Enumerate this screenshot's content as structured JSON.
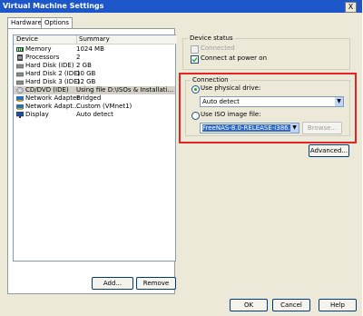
{
  "window": {
    "title": "Virtual Machine Settings",
    "close_glyph": "X"
  },
  "tabs": [
    {
      "label": "Hardware",
      "active": true
    },
    {
      "label": "Options",
      "active": false
    }
  ],
  "device_list": {
    "headers": {
      "device": "Device",
      "summary": "Summary"
    },
    "rows": [
      {
        "device": "Memory",
        "summary": "1024 MB",
        "icon": "memory-icon",
        "selected": false
      },
      {
        "device": "Processors",
        "summary": "2",
        "icon": "processor-icon",
        "selected": false
      },
      {
        "device": "Hard Disk (IDE)",
        "summary": "2 GB",
        "icon": "hard-disk-icon",
        "selected": false
      },
      {
        "device": "Hard Disk 2 (IDE)",
        "summary": "10 GB",
        "icon": "hard-disk-icon",
        "selected": false
      },
      {
        "device": "Hard Disk 3 (IDE)",
        "summary": "12 GB",
        "icon": "hard-disk-icon",
        "selected": false
      },
      {
        "device": "CD/DVD (IDE)",
        "summary": "Using file D:\\ISOs & Installati...",
        "icon": "cd-dvd-icon",
        "selected": true
      },
      {
        "device": "Network Adapter",
        "summary": "Bridged",
        "icon": "network-adapter-icon",
        "selected": false
      },
      {
        "device": "Network Adapt...",
        "summary": "Custom (VMnet1)",
        "icon": "network-adapter-icon",
        "selected": false
      },
      {
        "device": "Display",
        "summary": "Auto detect",
        "icon": "display-icon",
        "selected": false
      }
    ]
  },
  "list_buttons": {
    "add": "Add...",
    "remove": "Remove"
  },
  "device_status": {
    "title": "Device status",
    "connected": {
      "label": "Connected",
      "checked": false,
      "enabled": false
    },
    "connect_at_power_on": {
      "label": "Connect at power on",
      "checked": true
    }
  },
  "connection": {
    "title": "Connection",
    "physical": {
      "label": "Use physical drive:",
      "selected": true,
      "value": "Auto detect"
    },
    "iso": {
      "label": "Use ISO image file:",
      "selected": false,
      "value": "FreeNAS-8.0-RELEASE-i386.iso",
      "browse_label": "Browse..."
    }
  },
  "advanced_label": "Advanced...",
  "footer": {
    "ok": "OK",
    "cancel": "Cancel",
    "help": "Help"
  },
  "colors": {
    "titlebar": "#1d56c9",
    "highlight_box": "#e52323",
    "dialog_bg": "#ece9d8",
    "selection": "#d4d0c8"
  }
}
